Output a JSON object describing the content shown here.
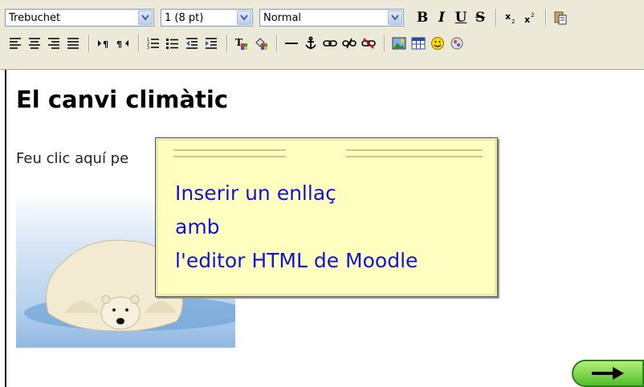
{
  "toolbar": {
    "font_family": "Trebuchet",
    "font_size": "1 (8 pt)",
    "paragraph_style": "Normal",
    "bold_label": "B",
    "italic_label": "I",
    "underline_label": "U",
    "strike_label": "S"
  },
  "content": {
    "title": "El canvi climàtic",
    "paragraph_text": "Feu clic aquí pe"
  },
  "tooltip": {
    "lines": [
      "Inserir un enllaç",
      "amb",
      "l'editor HTML de Moodle"
    ]
  },
  "colors": {
    "toolbar_bg": "#ece9d8",
    "tooltip_bg": "#ffffbf",
    "tooltip_text": "#1212d8",
    "next_button": "#4fbf2a"
  },
  "icons": {
    "row1": [
      "bold-icon",
      "italic-icon",
      "underline-icon",
      "strikethrough-icon",
      "subscript-icon",
      "superscript-icon",
      "paste-icon"
    ],
    "row2": [
      "align-left-icon",
      "align-center-icon",
      "align-right-icon",
      "justify-icon",
      "ltr-icon",
      "rtl-icon",
      "ordered-list-icon",
      "unordered-list-icon",
      "outdent-icon",
      "indent-icon",
      "text-color-icon",
      "background-color-icon",
      "horizontal-rule-icon",
      "anchor-icon",
      "link-icon",
      "unlink-icon",
      "nolink-icon",
      "insert-image-icon",
      "insert-table-icon",
      "smiley-icon",
      "special-char-icon"
    ]
  }
}
